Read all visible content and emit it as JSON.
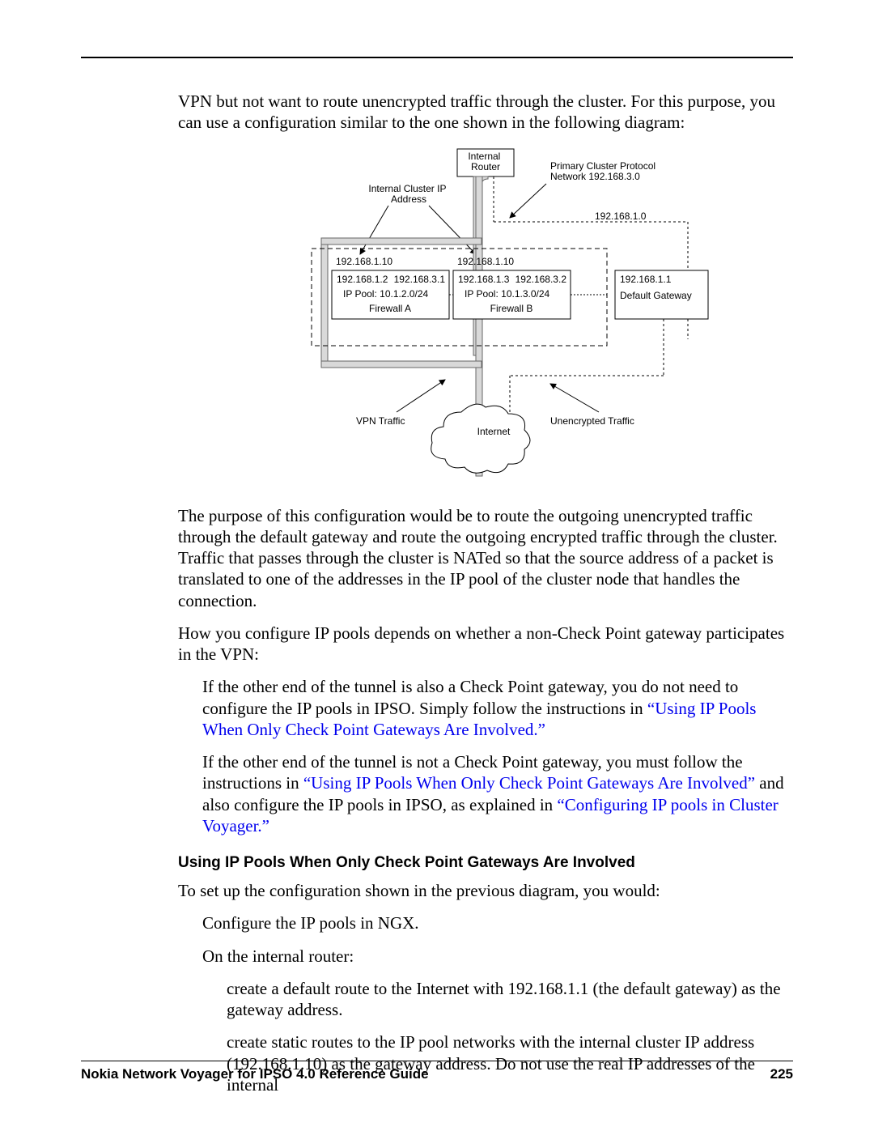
{
  "intro": {
    "p1": "VPN but not want to route unencrypted traffic through the cluster. For this purpose, you can use a configuration similar to the one shown in the following diagram:"
  },
  "diagram": {
    "internal_router": "Internal\nRouter",
    "primary_cluster": "Primary Cluster Protocol\nNetwork 192.168.3.0",
    "internal_cluster_ip": "Internal Cluster IP\nAddress",
    "net_right": "192.168.1.0",
    "fwA_top": "192.168.1.10",
    "fwB_top": "192.168.1.10",
    "fwA_l1": "192.168.1.2",
    "fwA_r1": "192.168.3.1",
    "fwA_pool": "IP Pool: 10.1.2.0/24",
    "fwA_name": "Firewall A",
    "fwB_l1": "192.168.1.3",
    "fwB_r1": "192.168.3.2",
    "fwB_pool": "IP Pool: 10.1.3.0/24",
    "fwB_name": "Firewall B",
    "gw_ip": "192.168.1.1",
    "gw_name": "Default Gateway",
    "vpn_traffic": "VPN Traffic",
    "unencrypted": "Unencrypted Traffic",
    "internet": "Internet"
  },
  "after": {
    "p1": "The purpose of this configuration would be to route the outgoing unencrypted traffic through the default gateway and route the outgoing encrypted traffic through the cluster. Traffic that passes through the cluster is NATed so that the source address of a packet is translated to one of the addresses in the IP pool of the cluster node that handles the connection.",
    "p2": "How you configure IP pools depends on whether a non-Check Point gateway participates in the VPN:",
    "li1a": "If the other end of the tunnel is also a Check Point gateway, you do not need to configure the IP pools in IPSO. Simply follow the instructions in ",
    "li1link": "“Using IP Pools When Only Check Point Gateways Are Involved.”",
    "li2a": "If the other end of the tunnel is not a Check Point gateway, you must follow the instructions in ",
    "li2link1": "“Using IP Pools When Only Check Point Gateways Are Involved”",
    "li2b": " and also configure the IP pools in IPSO, as explained in ",
    "li2link2": "“Configuring IP pools in Cluster Voyager.”"
  },
  "section": {
    "heading": "Using IP Pools When Only Check Point Gateways Are Involved",
    "p1": "To set up the configuration shown in the previous diagram, you would:",
    "s1": "Configure the IP pools in NGX.",
    "s2": "On the internal router:",
    "s2a": "create a default route to the Internet with 192.168.1.1 (the default gateway) as the gateway address.",
    "s2b": "create static routes to the IP pool networks with the internal cluster IP address (192.168.1.10) as the gateway address. Do not use the real IP addresses of the internal"
  },
  "footer": {
    "title": "Nokia Network Voyager for IPSO 4.0 Reference Guide",
    "page": "225"
  }
}
